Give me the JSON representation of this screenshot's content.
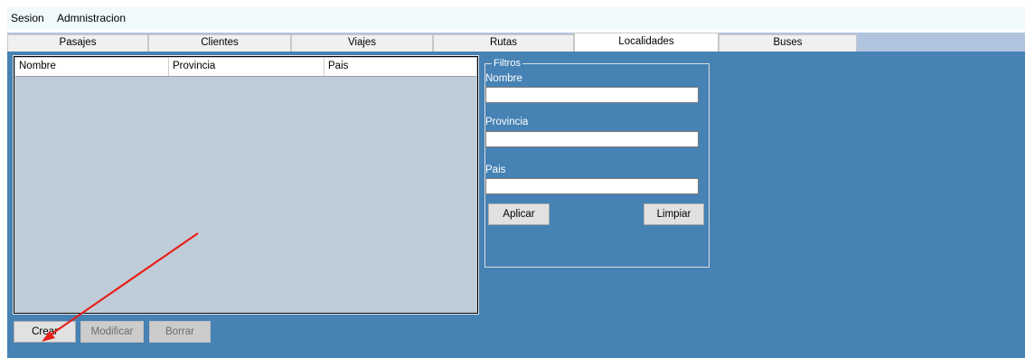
{
  "menu": {
    "items": [
      "Sesion",
      "Admnistracion"
    ]
  },
  "tabs": [
    "Pasajes",
    "Clientes",
    "Viajes",
    "Rutas",
    "Localidades",
    "Buses"
  ],
  "active_tab": "Localidades",
  "grid": {
    "columns": [
      "Nombre",
      "Provincia",
      "Pais"
    ],
    "rows": []
  },
  "filters": {
    "legend": "Filtros",
    "nombre_label": "Nombre",
    "nombre_value": "",
    "provincia_label": "Provincia",
    "provincia_value": "",
    "pais_label": "Pais",
    "pais_value": "",
    "apply_label": "Aplicar",
    "clear_label": "Limpiar"
  },
  "actions": {
    "create_label": "Crear",
    "modify_label": "Modificar",
    "delete_label": "Borrar"
  },
  "annotation": {
    "type": "arrow",
    "color": "#e8201a",
    "points_to": "Crear"
  },
  "colors": {
    "form_background": "#4682b4",
    "grid_background": "#bfcdd9",
    "tab_strip": "#b0c4de",
    "menubar": "#f0f9fc"
  }
}
